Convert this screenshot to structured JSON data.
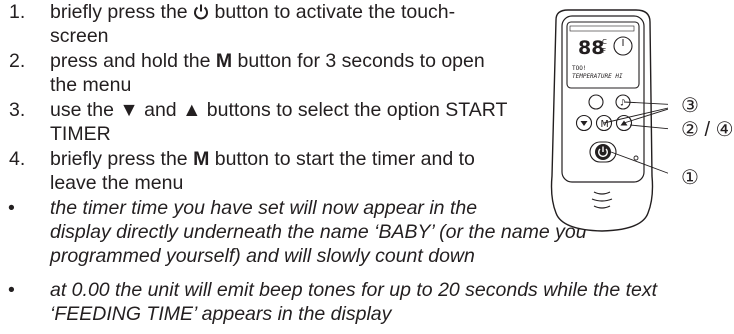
{
  "steps": [
    {
      "num": "1.",
      "line1_before": "briefly press the ",
      "icon": "power-icon",
      "line1_after": " button to activate the touch-",
      "line2": "screen"
    },
    {
      "num": "2.",
      "line1_before": "press and hold the ",
      "key": "M",
      "line1_after": " button for 3 seconds to open",
      "line2": "the menu"
    },
    {
      "num": "3.",
      "line1_before": "use the ",
      "down": "▼",
      "mid": " and ",
      "up": "▲",
      "line1_after": " buttons to select the option START",
      "line2": "TIMER"
    },
    {
      "num": "4.",
      "line1_before": "briefly press the ",
      "key": "M",
      "line1_after": " button to start the timer and to",
      "line2": "leave the menu"
    }
  ],
  "bullets": [
    {
      "lines": [
        "the timer time you have set will now appear in the",
        "display directly underneath the name ‘BABY’ (or the name you",
        "programmed yourself) and will slowly count down"
      ]
    },
    {
      "lines": [
        "at 0.00 the unit will emit beep tones for up to 20 seconds while the text",
        "‘FEEDING TIME’ appears in the display"
      ]
    }
  ],
  "bullet_char": "•",
  "device": {
    "lcd_digits": "88",
    "lcd_unit_c": "C",
    "lcd_unit_f": "F",
    "lcd_line1": "TOO!",
    "lcd_line2": "TEMPERATURE HI",
    "btn_m": "M"
  },
  "callouts": {
    "c1": "①",
    "c2": "②",
    "sep": " / ",
    "c3": "③",
    "c4": "④"
  }
}
